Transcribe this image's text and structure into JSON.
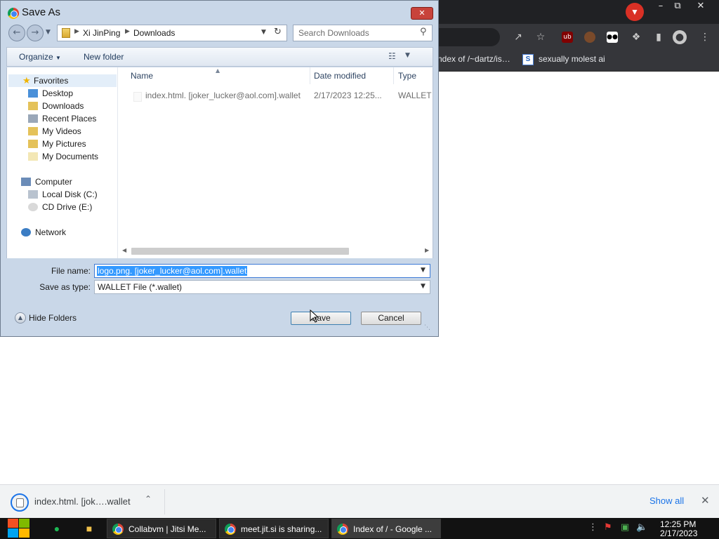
{
  "dialog": {
    "title": "Save As",
    "breadcrumb": [
      "Xi JinPing",
      "Downloads"
    ],
    "search_placeholder": "Search Downloads",
    "organize_label": "Organize",
    "new_folder_label": "New folder",
    "nav_tree": {
      "favorites": "Favorites",
      "favorites_items": [
        "Desktop",
        "Downloads",
        "Recent Places",
        "My Videos",
        "My Pictures",
        "My Documents"
      ],
      "computer": "Computer",
      "computer_items": [
        "Local Disk (C:)",
        "CD Drive (E:)"
      ],
      "network": "Network"
    },
    "columns": [
      "Name",
      "Date modified",
      "Type"
    ],
    "files": [
      {
        "name": "index.html. [joker_lucker@aol.com].wallet",
        "date_modified": "2/17/2023 12:25...",
        "type": "WALLET"
      }
    ],
    "file_name_label": "File name:",
    "file_name_value": "logo.png. [joker_lucker@aol.com].wallet",
    "save_as_type_label": "Save as type:",
    "save_as_type_value": "WALLET File (*.wallet)",
    "hide_folders_label": "Hide Folders",
    "save_button": "Save",
    "cancel_button": "Cancel"
  },
  "browser": {
    "bookmarks": [
      "ndex of /~dartz/is…",
      "sexually molest ai"
    ],
    "download_item": "index.html. [jok….wallet",
    "show_all": "Show all"
  },
  "taskbar": {
    "tasks": [
      "Collabvm | Jitsi Me...",
      "meet.jit.si is sharing...",
      "Index of / - Google ..."
    ],
    "time": "12:25 PM",
    "date": "2/17/2023"
  },
  "colors": {
    "accent": "#3399ff",
    "chrome_dark": "#35363a",
    "dialog_frame": "#c9d7e8",
    "link": "#1a73e8"
  }
}
